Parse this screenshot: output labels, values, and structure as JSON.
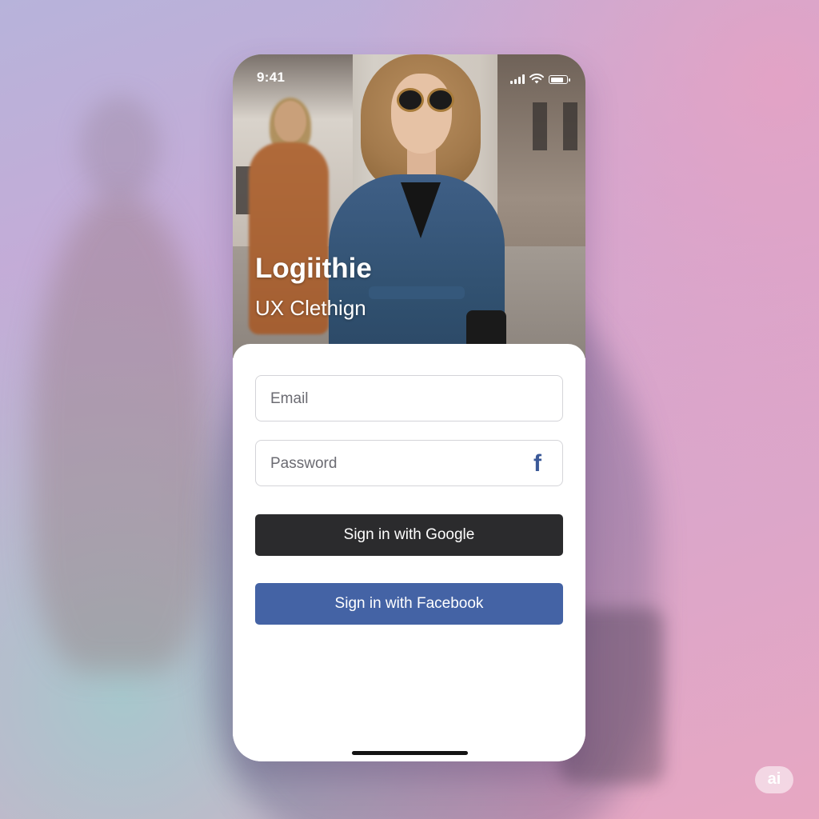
{
  "status_bar": {
    "time": "9:41",
    "battery_level": 0.85
  },
  "hero": {
    "title": "Logiithie",
    "subtitle": "UX Clethign"
  },
  "form": {
    "email_placeholder": "Email",
    "password_placeholder": "Password",
    "password_icon": "facebook-icon",
    "google_button_label": "Sign in with Google",
    "facebook_button_label": "Sign in with Facebook"
  },
  "watermark": {
    "text": "ai"
  },
  "colors": {
    "google_button": "#2b2b2d",
    "facebook_button": "#4463a5",
    "facebook_icon": "#3b5998",
    "sheet_background": "#ffffff"
  }
}
